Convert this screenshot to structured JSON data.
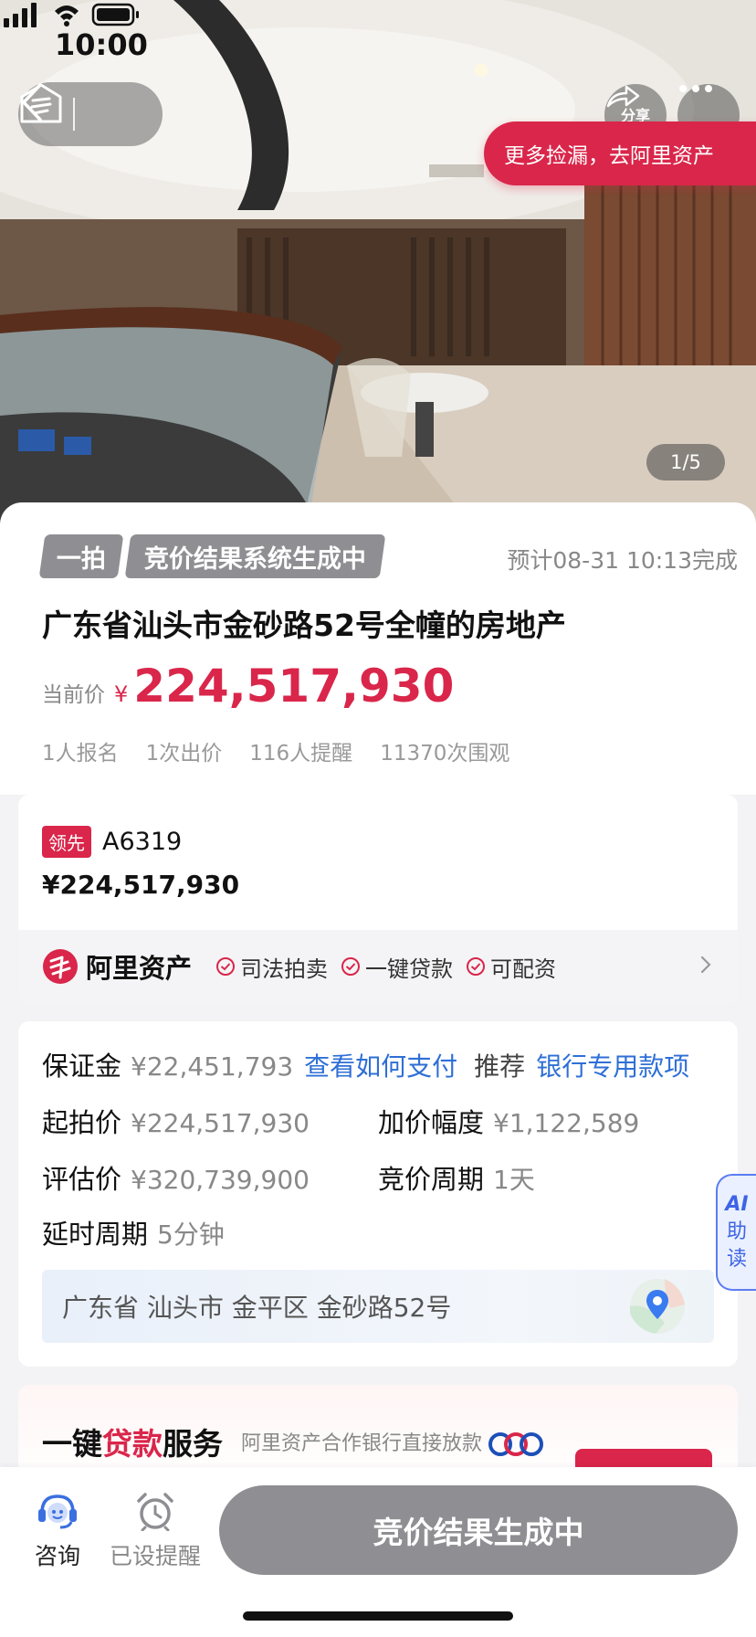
{
  "status_bar": {
    "time": "10:00"
  },
  "top_nav": {
    "share_label": "分享",
    "photo_counter": "1/5"
  },
  "auction": {
    "round_tag": "一拍",
    "status_tag": "竞价结果系统生成中",
    "eta": "预计08-31 10:13完成",
    "title": "广东省汕头市金砂路52号全幢的房地产",
    "promo": "更多捡漏，去阿里资产",
    "price_label": "当前价",
    "price_currency": "¥",
    "price_value": "224,517,930",
    "stats": [
      "1人报名",
      "1次出价",
      "116人提醒",
      "11370次围观"
    ]
  },
  "leader": {
    "badge": "领先",
    "bidder_id": "A6319",
    "bid_price": "¥224,517,930"
  },
  "ali_bar": {
    "name": "阿里资产",
    "features": [
      "司法拍卖",
      "一键贷款",
      "可配资"
    ]
  },
  "info": {
    "deposit_label": "保证金",
    "deposit_value": "¥22,451,793",
    "deposit_link": "查看如何支付",
    "recommend_label": "推荐",
    "recommend_link": "银行专用款项",
    "start_label": "起拍价",
    "start_value": "¥224,517,930",
    "increment_label": "加价幅度",
    "increment_value": "¥1,122,589",
    "appraisal_label": "评估价",
    "appraisal_value": "¥320,739,900",
    "cycle_label": "竞价周期",
    "cycle_value": "1天",
    "delay_label": "延时周期",
    "delay_value": "5分钟",
    "address": "广东省 汕头市 金平区 金砂路52号"
  },
  "ai_tab": {
    "ai": "AI",
    "line1": "助",
    "line2": "读"
  },
  "loan": {
    "title_a": "一键",
    "title_red": "贷款",
    "title_b": "服务",
    "subtitle": "阿里资产合作银行直接放款"
  },
  "bottom_bar": {
    "consult_label": "咨询",
    "remind_label": "已设提醒",
    "cta_label": "竞价结果生成中"
  },
  "colors": {
    "accent": "#d9264a",
    "link": "#2f6fd6",
    "disabled": "#8f8f93"
  }
}
